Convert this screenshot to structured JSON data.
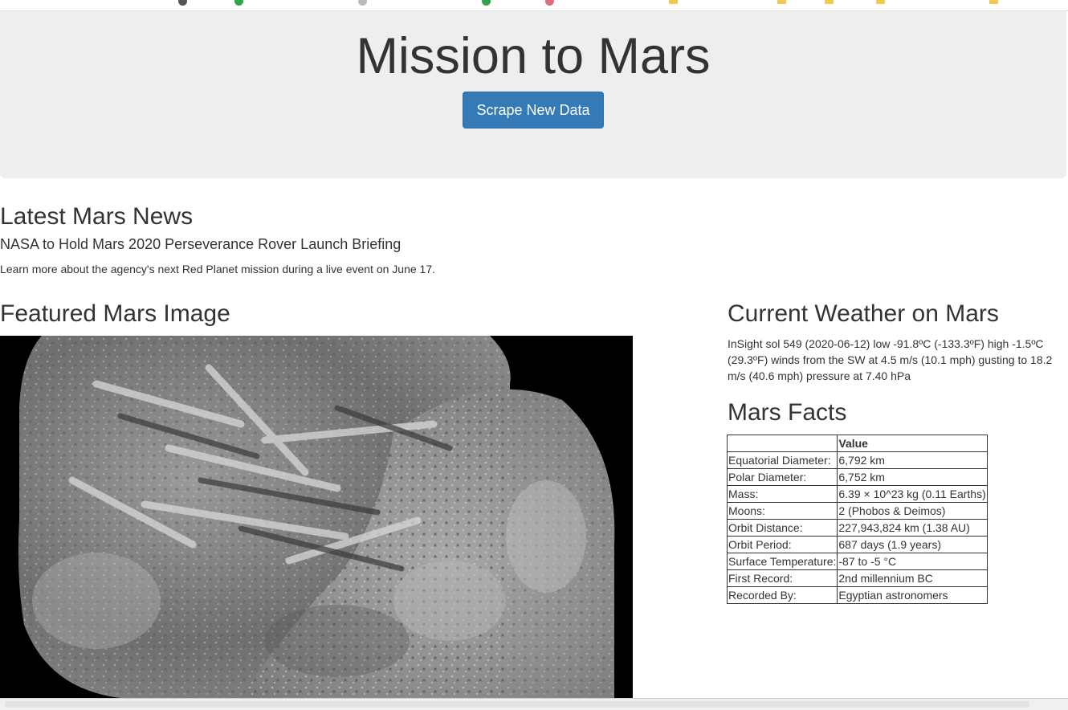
{
  "jumbotron": {
    "title": "Mission to Mars",
    "button_label": "Scrape New Data",
    "button_color": "#337ab7"
  },
  "news": {
    "heading": "Latest Mars News",
    "title": "NASA to Hold Mars 2020 Perseverance Rover Launch Briefing",
    "paragraph": "Learn more about the agency's next Red Planet mission during a live event on June 17."
  },
  "featured": {
    "heading": "Featured Mars Image"
  },
  "weather": {
    "heading": "Current Weather on Mars",
    "text": "InSight sol 549 (2020-06-12) low -91.8ºC (-133.3ºF) high -1.5ºC (29.3ºF) winds from the SW at 4.5 m/s (10.1 mph) gusting to 18.2 m/s (40.6 mph) pressure at 7.40 hPa"
  },
  "facts": {
    "heading": "Mars Facts",
    "columns": [
      "",
      "Value"
    ],
    "rows": [
      {
        "label": "Equatorial Diameter:",
        "value": "6,792 km"
      },
      {
        "label": "Polar Diameter:",
        "value": "6,752 km"
      },
      {
        "label": "Mass:",
        "value": "6.39 × 10^23 kg (0.11 Earths)"
      },
      {
        "label": "Moons:",
        "value": "2 (Phobos & Deimos)"
      },
      {
        "label": "Orbit Distance:",
        "value": "227,943,824 km (1.38 AU)"
      },
      {
        "label": "Orbit Period:",
        "value": "687 days (1.9 years)"
      },
      {
        "label": "Surface Temperature:",
        "value": "-87 to -5 °C"
      },
      {
        "label": "First Record:",
        "value": "2nd millennium BC"
      },
      {
        "label": "Recorded By:",
        "value": "Egyptian astronomers"
      }
    ]
  }
}
